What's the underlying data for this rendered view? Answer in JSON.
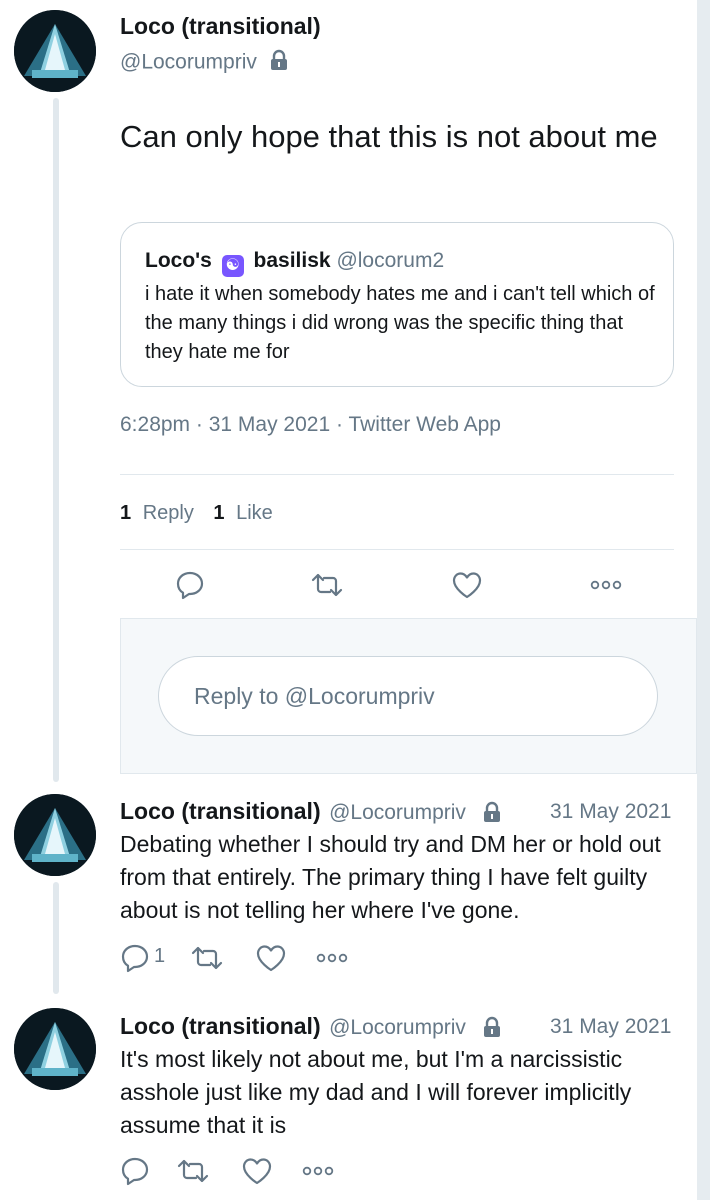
{
  "main_tweet": {
    "display_name": "Loco (transitional)",
    "handle": "@Locorumpriv",
    "text": "Can only hope that this is not about me",
    "quoted": {
      "display_name_before_emoji": "Loco's",
      "emoji": "yin-yang-emoji",
      "display_name_after_emoji": "basilisk",
      "handle": "@locorum2",
      "text": "i hate it when somebody hates me and i can't tell which of the many things i did wrong was the specific thing that they hate me for"
    },
    "time": "6:28pm",
    "date": "31 May 2021",
    "source": "Twitter Web App",
    "separator": "·",
    "stats": {
      "replies_count": "1",
      "replies_label": "Reply",
      "likes_count": "1",
      "likes_label": "Like"
    }
  },
  "reply_box": {
    "placeholder": "Reply to @Locorumpriv"
  },
  "replies": [
    {
      "display_name": "Loco (transitional)",
      "handle": "@Locorumpriv",
      "date": "31 May 2021",
      "text": "Debating whether I should try and DM her or hold out from that entirely. The primary thing I have felt guilty about is not telling her where I've gone.",
      "reply_count": "1"
    },
    {
      "display_name": "Loco (transitional)",
      "handle": "@Locorumpriv",
      "date": "31 May 2021",
      "text": "It's most likely not about me, but I'm a narcissistic asshole just like my dad and I will forever implicitly assume that it is",
      "reply_count": ""
    }
  ],
  "colors": {
    "text": "#14171a",
    "secondary": "#657786",
    "border": "#e1e8ed",
    "background_light": "#f5f8fa"
  }
}
